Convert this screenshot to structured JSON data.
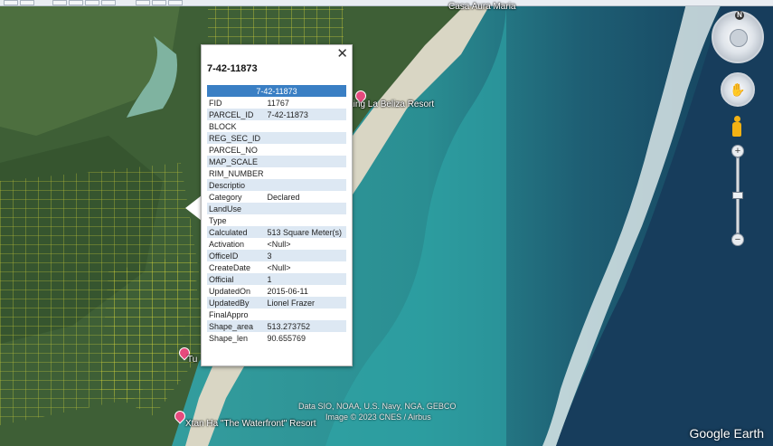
{
  "map": {
    "place_labels": [
      {
        "name": "Casa Aura Maria"
      },
      {
        "name": "King La Beliza Resort"
      },
      {
        "name": "Xtan Ha \"The Waterfront\" Resort"
      },
      {
        "name": "Tu"
      }
    ],
    "attribution_line1": "Data SIO, NOAA, U.S. Navy, NGA, GEBCO",
    "attribution_line2": "Image © 2023 CNES / Airbus",
    "logo": "Google Earth"
  },
  "popup": {
    "title": "7-42-11873",
    "table_header": "7-42-11873",
    "close_icon": "✕",
    "rows": [
      {
        "key": "FID",
        "value": "11767"
      },
      {
        "key": "PARCEL_ID",
        "value": "7-42-11873"
      },
      {
        "key": "BLOCK",
        "value": ""
      },
      {
        "key": "REG_SEC_ID",
        "value": ""
      },
      {
        "key": "PARCEL_NO",
        "value": ""
      },
      {
        "key": "MAP_SCALE",
        "value": ""
      },
      {
        "key": "RIM_NUMBER",
        "value": ""
      },
      {
        "key": "Descriptio",
        "value": ""
      },
      {
        "key": "Category",
        "value": "Declared"
      },
      {
        "key": "LandUse",
        "value": ""
      },
      {
        "key": "Type",
        "value": ""
      },
      {
        "key": "Calculated",
        "value": "513 Square Meter(s)"
      },
      {
        "key": "Activation",
        "value": "<Null>"
      },
      {
        "key": "OfficeID",
        "value": "3"
      },
      {
        "key": "CreateDate",
        "value": "<Null>"
      },
      {
        "key": "Official",
        "value": "1"
      },
      {
        "key": "UpdatedOn",
        "value": "2015-06-11"
      },
      {
        "key": "UpdatedBy",
        "value": "Lionel Frazer"
      },
      {
        "key": "FinalAppro",
        "value": ""
      },
      {
        "key": "Shape_area",
        "value": "513.273752"
      },
      {
        "key": "Shape_len",
        "value": "90.655769"
      }
    ]
  },
  "nav": {
    "compass_north": "N",
    "zoom_in": "+",
    "zoom_out": "−",
    "look_icon": "✋",
    "zoom_level": 0.5
  },
  "colors": {
    "header_blue": "#3a7fc4",
    "row_alt": "#dde8f3",
    "pin": "#e64a7d",
    "parcel_lines": "#d8d83a"
  }
}
